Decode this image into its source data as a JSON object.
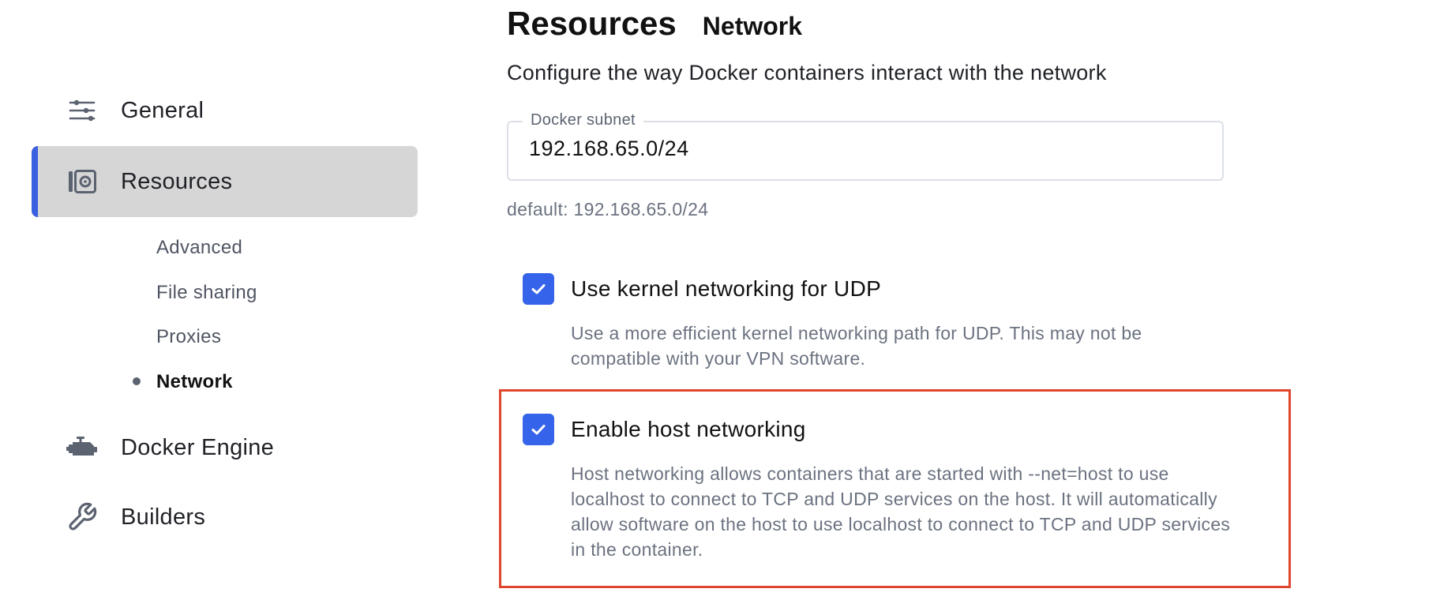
{
  "sidebar": {
    "items": [
      {
        "label": "General",
        "icon": "sliders-icon"
      },
      {
        "label": "Resources",
        "icon": "resources-icon",
        "active": true
      },
      {
        "label": "Docker Engine",
        "icon": "engine-icon"
      },
      {
        "label": "Builders",
        "icon": "wrench-icon"
      }
    ],
    "resources_sub": [
      {
        "label": "Advanced"
      },
      {
        "label": "File sharing"
      },
      {
        "label": "Proxies"
      },
      {
        "label": "Network",
        "active": true
      }
    ]
  },
  "main": {
    "title": "Resources",
    "subtitle": "Network",
    "description": "Configure the way Docker containers interact with the network",
    "subnet": {
      "label": "Docker subnet",
      "value": "192.168.65.0/24",
      "default_text": "default: 192.168.65.0/24"
    },
    "options": [
      {
        "label": "Use kernel networking for UDP",
        "checked": true,
        "description": "Use a more efficient kernel networking path for UDP. This may not be compatible with your VPN software."
      },
      {
        "label": "Enable host networking",
        "checked": true,
        "description": "Host networking allows containers that are started with --net=host to use localhost to connect to TCP and UDP services on the host. It will automatically allow software on the host to use localhost to connect to TCP and UDP services in the container."
      }
    ]
  },
  "colors": {
    "accent": "#3563e9",
    "active_indicator": "#3a5fe0",
    "active_background": "#d6d6d6",
    "highlight_border": "#e0452e",
    "muted_text": "#6b7280"
  }
}
